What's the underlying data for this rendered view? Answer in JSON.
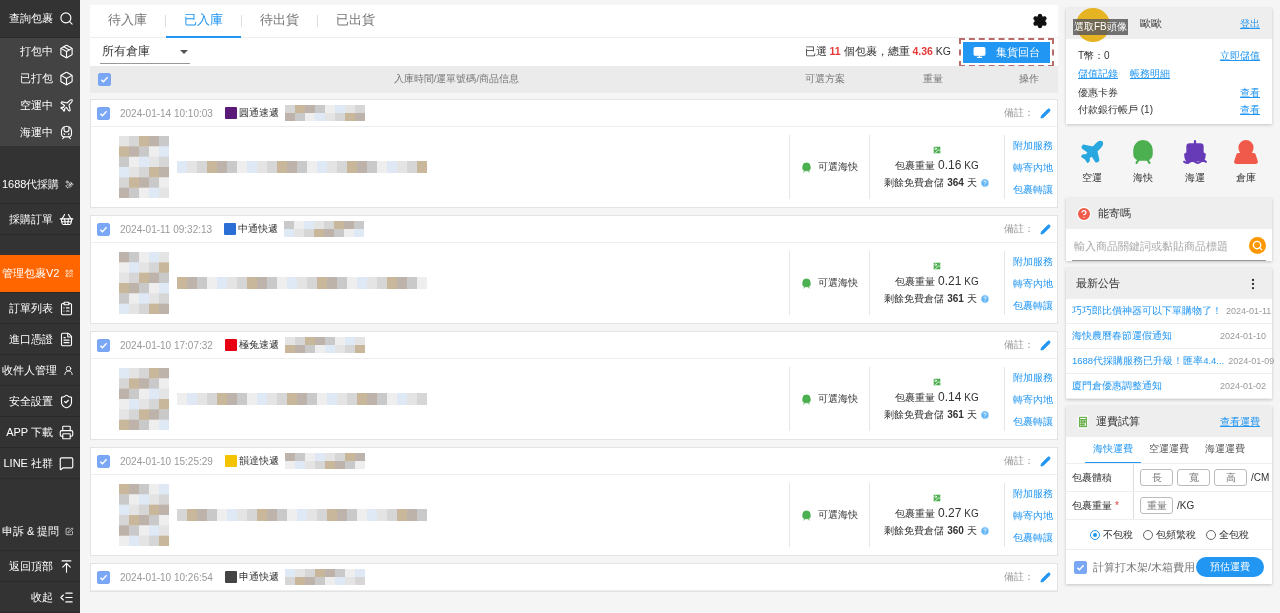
{
  "sidebar": {
    "sections": [
      [
        {
          "label": "查詢包裹",
          "kind": "main",
          "selected": false
        },
        {
          "label": "打包中",
          "kind": "sub",
          "selected": false
        },
        {
          "label": "已打包",
          "kind": "sub",
          "selected": false
        },
        {
          "label": "空運中",
          "kind": "sub",
          "selected": false
        },
        {
          "label": "海運中",
          "kind": "sub",
          "selected": false
        }
      ],
      [
        {
          "label": "1688代採購",
          "kind": "main",
          "selected": false
        },
        {
          "label": "採購訂單",
          "kind": "main",
          "selected": false
        }
      ],
      [
        {
          "label": "管理包裹V2",
          "kind": "main",
          "selected": true
        },
        {
          "label": "訂單列表",
          "kind": "main",
          "selected": false
        },
        {
          "label": "進口憑證",
          "kind": "main",
          "selected": false
        },
        {
          "label": "收件人管理",
          "kind": "main",
          "selected": false
        },
        {
          "label": "安全設置",
          "kind": "main",
          "selected": false
        },
        {
          "label": "APP 下載",
          "kind": "main",
          "selected": false
        },
        {
          "label": "LINE 社群",
          "kind": "main",
          "selected": false
        }
      ],
      [
        {
          "label": "申訴 & 提問",
          "kind": "main",
          "selected": false
        },
        {
          "label": "返回頂部",
          "kind": "main",
          "selected": false
        },
        {
          "label": "收起",
          "kind": "main",
          "selected": false
        }
      ]
    ]
  },
  "tabs": [
    {
      "label": "待入庫",
      "selected": false
    },
    {
      "label": "已入庫",
      "selected": true
    },
    {
      "label": "待出貨",
      "selected": false
    },
    {
      "label": "已出貨",
      "selected": false
    }
  ],
  "warehouse_select": "所有倉庫",
  "summary": {
    "text_1": "已選",
    "count": "11",
    "text_2": "個包裹，總重",
    "weight": "4.36",
    "unit": "KG"
  },
  "consolidate_button": "集貨回台",
  "table_header": {
    "select_all": true,
    "columns": [
      "入庫時間/運單號碼/商品信息",
      "可選方案",
      "重量",
      "操作"
    ]
  },
  "packages": [
    {
      "checked": true,
      "time": "2024-01-14 10:10:03",
      "courier": "圓通速遞",
      "color": "#5b1a78",
      "note_label": "備註：",
      "option": "可選海快",
      "weight_label": "包裹重量",
      "weight": "0.16",
      "unit": "KG",
      "storage_label": "剩餘免費倉儲",
      "days": "364",
      "days_unit": "天",
      "actions": [
        "附加服務",
        "轉寄內地",
        "包裹轉讓"
      ]
    },
    {
      "checked": true,
      "time": "2024-01-11 09:32:13",
      "courier": "中通快遞",
      "color": "#2b6fd6",
      "note_label": "備註：",
      "option": "可選海快",
      "weight_label": "包裹重量",
      "weight": "0.21",
      "unit": "KG",
      "storage_label": "剩餘免費倉儲",
      "days": "361",
      "days_unit": "天",
      "actions": [
        "附加服務",
        "轉寄內地",
        "包裹轉讓"
      ]
    },
    {
      "checked": true,
      "time": "2024-01-10 17:07:32",
      "courier": "極兔速遞",
      "color": "#e60012",
      "note_label": "備註：",
      "option": "可選海快",
      "weight_label": "包裹重量",
      "weight": "0.14",
      "unit": "KG",
      "storage_label": "剩餘免費倉儲",
      "days": "361",
      "days_unit": "天",
      "actions": [
        "附加服務",
        "轉寄內地",
        "包裹轉讓"
      ]
    },
    {
      "checked": true,
      "time": "2024-01-10 15:25:29",
      "courier": "韻達快遞",
      "color": "#f5c400",
      "note_label": "備註：",
      "option": "可選海快",
      "weight_label": "包裹重量",
      "weight": "0.27",
      "unit": "KG",
      "storage_label": "剩餘免費倉儲",
      "days": "360",
      "days_unit": "天",
      "actions": [
        "附加服務",
        "轉寄內地",
        "包裹轉讓"
      ]
    },
    {
      "checked": true,
      "time": "2024-01-10 10:26:54",
      "courier": "申通快遞",
      "color": "#444444",
      "note_label": "備註："
    }
  ],
  "user": {
    "avatar_label": "選取FB頭像",
    "name": "歐歐",
    "logout": "登出",
    "coins": "T幣：0",
    "top_up": "立即儲值",
    "links": [
      "儲值記錄",
      "帳務明細"
    ],
    "rows": [
      {
        "label": "優惠卡券",
        "link": "查看"
      },
      {
        "label": "付款銀行帳戶 (1)",
        "link": "查看"
      }
    ]
  },
  "shortcuts": [
    "空運",
    "海快",
    "海運",
    "倉庫"
  ],
  "can_ship": {
    "title": "能寄嗎",
    "placeholder": "輸入商品關鍵詞或黏貼商品標題"
  },
  "announcements": {
    "title": "最新公告",
    "items": [
      {
        "title": "巧巧郎比價神器可以下單購物了！",
        "date": "2024-01-11"
      },
      {
        "title": "海快農曆春節運假通知",
        "date": "2024-01-10"
      },
      {
        "title": "1688代採購服務已升級！匯率4.4...",
        "date": "2024-01-09"
      },
      {
        "title": "廈門倉優惠調整通知",
        "date": "2024-01-02"
      }
    ]
  },
  "calculator": {
    "title": "運費試算",
    "link": "查看運費",
    "tabs": [
      {
        "label": "海快運費",
        "selected": true
      },
      {
        "label": "空運運費",
        "selected": false
      },
      {
        "label": "海運運費",
        "selected": false
      }
    ],
    "volume_label": "包裹體積",
    "volume_fields": [
      "長",
      "寬",
      "高"
    ],
    "volume_unit": "/CM",
    "weight_label": "包裹重量",
    "weight_required": "*",
    "weight_field": "重量",
    "weight_unit": "/KG",
    "tax_options": [
      {
        "label": "不包稅",
        "selected": true
      },
      {
        "label": "包頻繁稅",
        "selected": false
      },
      {
        "label": "全包稅",
        "selected": false
      }
    ],
    "crate": {
      "label": "計算打木架/木箱費用",
      "checked": true
    },
    "estimate_button": "預估運費"
  }
}
